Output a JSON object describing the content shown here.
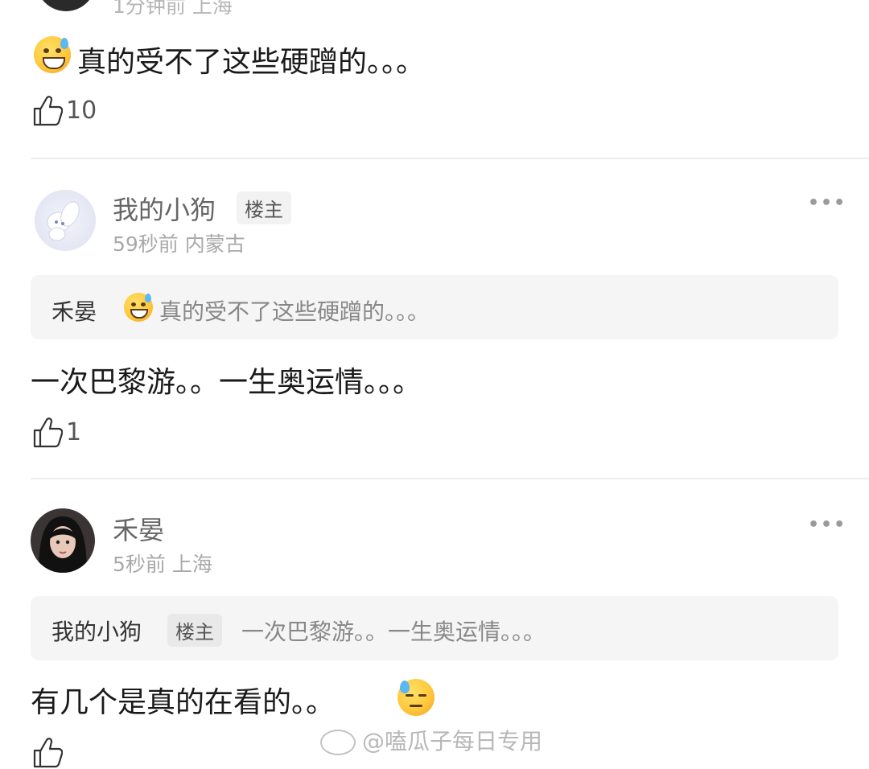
{
  "comment_top": {
    "meta": "1分钟前 上海",
    "content": "真的受不了这些硬蹭的。。。",
    "likes": "10"
  },
  "comment_1": {
    "username": "我的小狗",
    "badge": "楼主",
    "meta": "59秒前 内蒙古",
    "quote_name": "禾晏",
    "quote_text": "真的受不了这些硬蹭的。。。",
    "content": "一次巴黎游。。一生奥运情。。。",
    "likes": "1"
  },
  "comment_2": {
    "username": "禾晏",
    "meta": "5秒前 上海",
    "quote_name": "我的小狗",
    "quote_badge": "楼主",
    "quote_text": "一次巴黎游。。一生奥运情。。。",
    "content": "有几个是真的在看的。。"
  },
  "watermark": "@嗑瓜子每日专用",
  "more_icon": "more-dots-icon",
  "like_icon": "thumbs-up-icon"
}
